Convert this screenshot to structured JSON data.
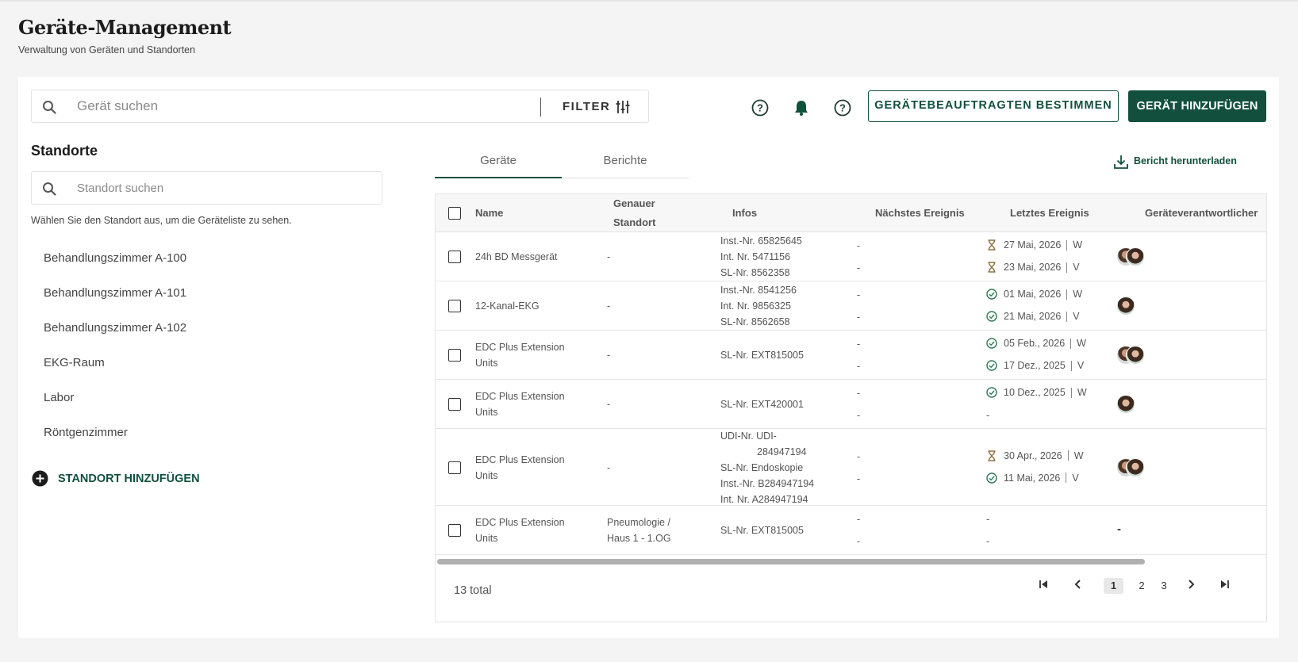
{
  "page": {
    "title": "Geräte-Management",
    "subtitle": "Verwaltung von Geräten und Standorten"
  },
  "toolbar": {
    "search_placeholder": "Gerät suchen",
    "filter_label": "FILTER",
    "assign_button": "GERÄTEBEAUFTRAGTEN BESTIMMEN",
    "add_button": "GERÄT HINZUFÜGEN"
  },
  "sidebar": {
    "title": "Standorte",
    "search_placeholder": "Standort suchen",
    "hint": "Wählen Sie den Standort aus, um die Geräteliste zu sehen.",
    "locations": [
      "Behandlungszimmer A-100",
      "Behandlungszimmer A-101",
      "Behandlungszimmer A-102",
      "EKG-Raum",
      "Labor",
      "Röntgenzimmer"
    ],
    "add_label": "STANDORT HINZUFÜGEN"
  },
  "tabs": [
    {
      "label": "Geräte",
      "active": true
    },
    {
      "label": "Berichte",
      "active": false
    }
  ],
  "download_label": "Bericht herunterladen",
  "table": {
    "columns": {
      "name": "Name",
      "location_1": "Genauer",
      "location_2": "Standort",
      "infos": "Infos",
      "next": "Nächstes Ereignis",
      "last": "Letztes Ereignis",
      "owner": "Geräteverantwortlicher"
    },
    "rows": [
      {
        "name1": "24h BD Messgerät",
        "name2": "",
        "loc1": "-",
        "loc2": "",
        "infos": [
          "Inst.-Nr. 65825645",
          "Int. Nr. 5471156",
          "SL-Nr. 8562358"
        ],
        "next": [
          "-",
          "-"
        ],
        "last": [
          {
            "icon": "hourglass-icon",
            "date": "27 Mai, 2026",
            "type": "W"
          },
          {
            "icon": "hourglass-icon",
            "date": "23 Mai, 2026",
            "type": "V"
          }
        ],
        "avatars": 2
      },
      {
        "name1": "12-Kanal-EKG",
        "name2": "",
        "loc1": "-",
        "loc2": "",
        "infos": [
          "Inst.-Nr. 8541256",
          "Int. Nr. 9856325",
          "SL-Nr. 8562658"
        ],
        "next": [
          "-",
          "-"
        ],
        "last": [
          {
            "icon": "check-circle-icon",
            "date": "01 Mai, 2026",
            "type": "W"
          },
          {
            "icon": "check-circle-icon",
            "date": "21 Mai, 2026",
            "type": "V"
          }
        ],
        "avatars": 1
      },
      {
        "name1": "EDC Plus Extension",
        "name2": "Units",
        "loc1": "-",
        "loc2": "",
        "infos": [
          "SL-Nr. EXT815005"
        ],
        "next": [
          "-",
          "-"
        ],
        "last": [
          {
            "icon": "check-circle-icon",
            "date": "05 Feb., 2026",
            "type": "W"
          },
          {
            "icon": "check-circle-icon",
            "date": "17 Dez., 2025",
            "type": "V"
          }
        ],
        "avatars": 2
      },
      {
        "name1": "EDC Plus Extension",
        "name2": "Units",
        "loc1": "-",
        "loc2": "",
        "infos": [
          "SL-Nr. EXT420001"
        ],
        "next": [
          "-",
          "-"
        ],
        "last": [
          {
            "icon": "check-circle-icon",
            "date": "10 Dez., 2025",
            "type": "W"
          },
          {
            "icon": "",
            "date": "-",
            "type": ""
          }
        ],
        "avatars": 1
      },
      {
        "name1": "EDC Plus Extension",
        "name2": "Units",
        "loc1": "-",
        "loc2": "",
        "infos": [
          "UDI-Nr. UDI-",
          "284947194",
          "SL-Nr. Endoskopie",
          "Inst.-Nr. B284947194",
          "Int. Nr. A284947194"
        ],
        "next": [
          "-",
          "-"
        ],
        "last": [
          {
            "icon": "hourglass-icon",
            "date": "30 Apr., 2026",
            "type": "W"
          },
          {
            "icon": "check-circle-icon",
            "date": "11 Mai, 2026",
            "type": "V"
          }
        ],
        "avatars": 2
      },
      {
        "name1": "EDC Plus Extension",
        "name2": "Units",
        "loc1": "Pneumologie /",
        "loc2": "Haus 1 - 1.OG",
        "infos": [
          "SL-Nr. EXT815005"
        ],
        "next": [
          "-",
          "-"
        ],
        "last": [
          {
            "icon": "",
            "date": "-",
            "type": ""
          },
          {
            "icon": "",
            "date": "-",
            "type": ""
          }
        ],
        "avatars": 0,
        "owner_text": "-"
      }
    ]
  },
  "pagination": {
    "total": "13 total",
    "pages": [
      "1",
      "2",
      "3"
    ],
    "current": "1"
  },
  "colors": {
    "brand": "#12503d",
    "hourglass": "#8a6a3a",
    "check": "#2f7a55"
  }
}
